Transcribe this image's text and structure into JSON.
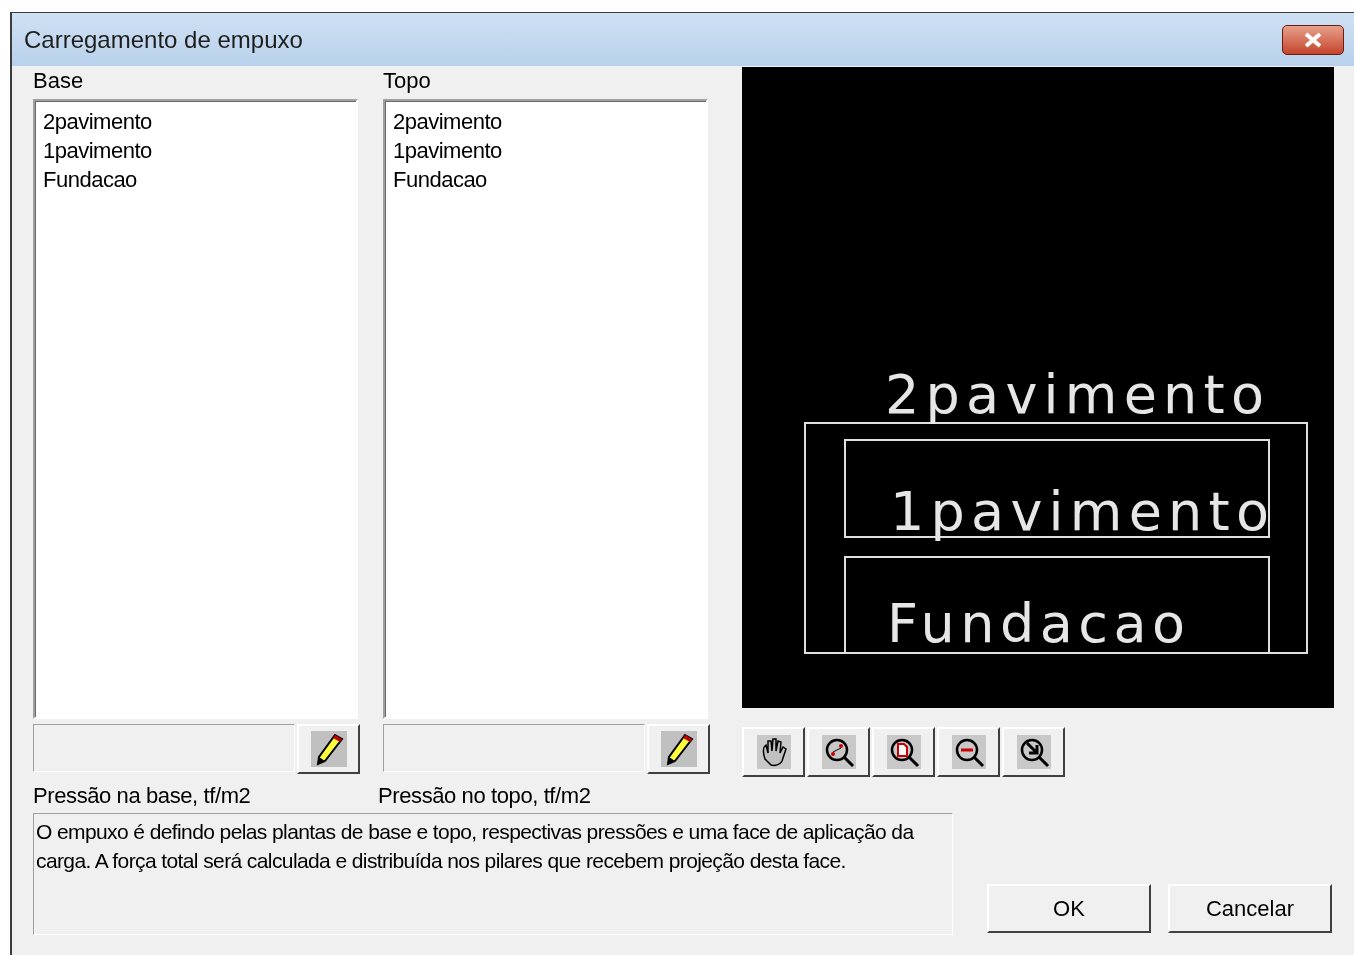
{
  "window": {
    "title": "Carregamento de empuxo"
  },
  "base": {
    "label": "Base",
    "items": [
      {
        "text": "2pavimento",
        "selected": false
      },
      {
        "text": "1pavimento",
        "selected": false
      },
      {
        "text": "Fundacao",
        "selected": false
      }
    ],
    "pressure_label": "Pressão na base, tf/m2"
  },
  "topo": {
    "label": "Topo",
    "items": [
      {
        "text": "2pavimento",
        "selected": false
      },
      {
        "text": "1pavimento",
        "selected": false
      },
      {
        "text": "Fundacao",
        "selected": false
      }
    ],
    "pressure_label": "Pressão no topo, tf/m2"
  },
  "preview": {
    "labels": [
      "2pavimento",
      "1pavimento",
      "Fundacao"
    ]
  },
  "description": "O empuxo é defindo pelas plantas de base e topo, respectivas pressões e uma face de aplicação da carga. A força total será calculada e distribuída nos pilares que recebem projeção desta face.",
  "buttons": [
    "OK",
    "Cancelar"
  ]
}
